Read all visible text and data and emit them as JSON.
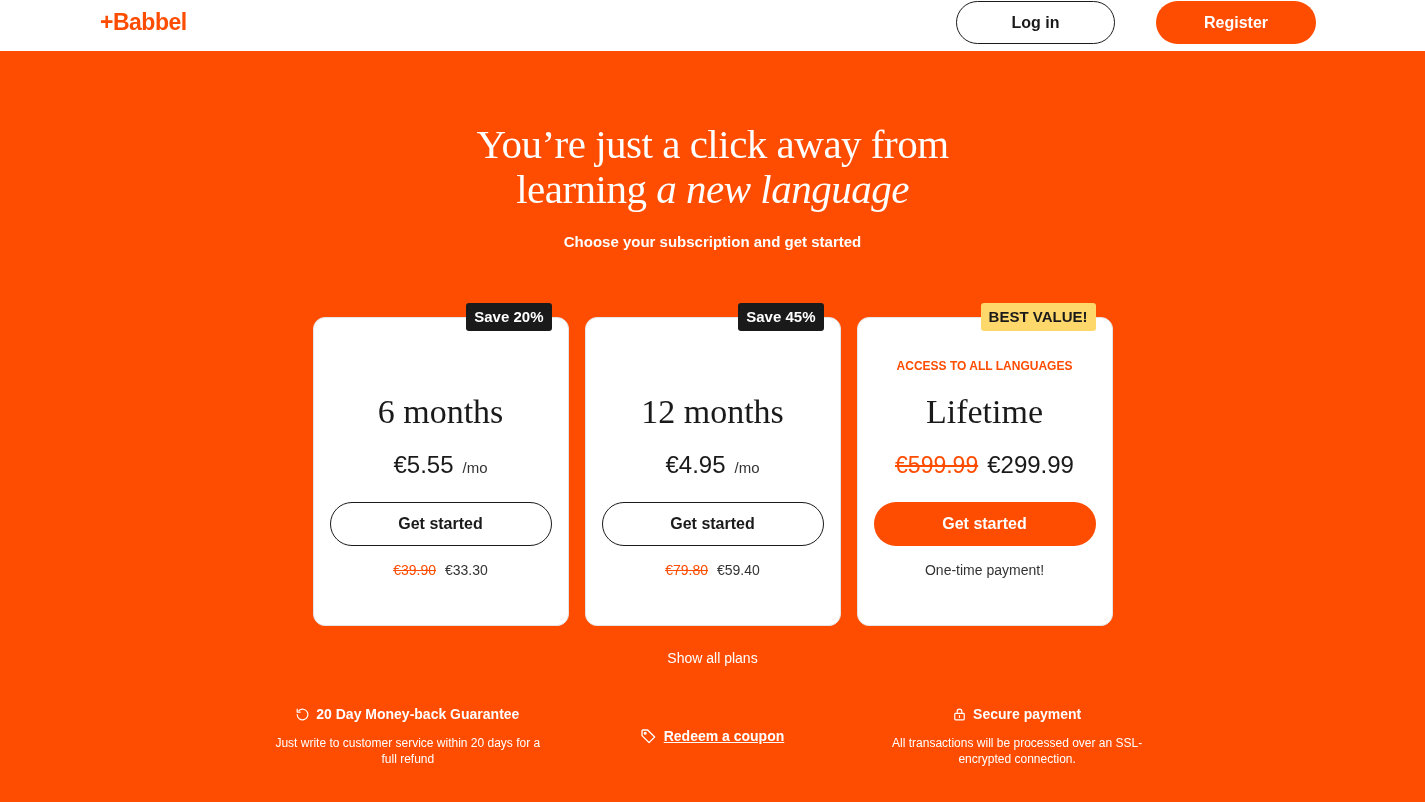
{
  "header": {
    "logo": "+Babbel",
    "buttons": [
      {
        "label": "Log in",
        "primary": false
      },
      {
        "label": "Register",
        "primary": true
      }
    ]
  },
  "hero": {
    "title": "You’re just a click away from learning *a new language*",
    "subtitle": "Choose your subscription and get started"
  },
  "plans": [
    {
      "badge": {
        "label": "Save 20%",
        "kind": "dark"
      },
      "name": "6 months",
      "price": "€5.55",
      "unit": "/mo",
      "button": {
        "label": "Get started",
        "primary": false
      },
      "note_old": "€39.90",
      "note": "€33.30"
    },
    {
      "badge": {
        "label": "Save 45%",
        "kind": "dark"
      },
      "name": "12 months",
      "price": "€4.95",
      "unit": "/mo",
      "button": {
        "label": "Get started",
        "primary": false
      },
      "note_old": "€79.80",
      "note": "€59.40"
    },
    {
      "badge": {
        "label": "BEST VALUE!",
        "kind": "highlight"
      },
      "eyebrow": "ACCESS TO ALL LANGUAGES",
      "name": "Lifetime",
      "old_price": "€599.99",
      "price": "€299.99",
      "button": {
        "label": "Get started",
        "primary": true
      },
      "note": "One-time payment!"
    }
  ],
  "show_all": "Show all plans",
  "features": [
    {
      "kind": "guarantee",
      "title": "20 Day Money-back Guarantee",
      "text": "Just write to customer service within 20 days for a full refund"
    },
    {
      "kind": "coupon",
      "link": "Redeem a coupon"
    },
    {
      "kind": "secure",
      "title": "Secure payment",
      "text": "All transactions will be processed over an SSL-encrypted connection."
    }
  ]
}
